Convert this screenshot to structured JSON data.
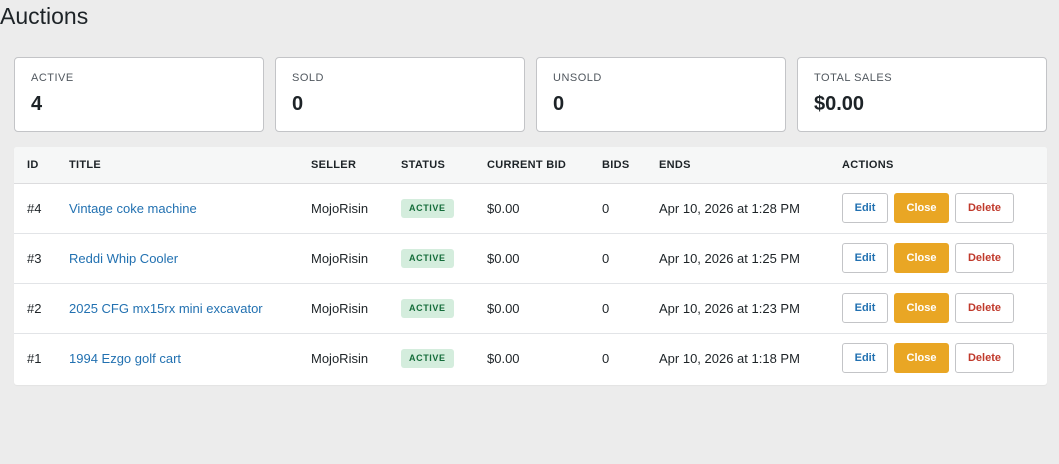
{
  "page": {
    "title": "Auctions"
  },
  "stats": [
    {
      "label": "ACTIVE",
      "value": "4"
    },
    {
      "label": "SOLD",
      "value": "0"
    },
    {
      "label": "UNSOLD",
      "value": "0"
    },
    {
      "label": "TOTAL SALES",
      "value": "$0.00"
    }
  ],
  "table": {
    "headers": [
      "ID",
      "TITLE",
      "SELLER",
      "STATUS",
      "CURRENT BID",
      "BIDS",
      "ENDS",
      "ACTIONS"
    ],
    "rows": [
      {
        "id": "#4",
        "title": "Vintage coke machine",
        "seller": "MojoRisin",
        "status": "ACTIVE",
        "current_bid": "$0.00",
        "bids": "0",
        "ends": "Apr 10, 2026 at 1:28 PM"
      },
      {
        "id": "#3",
        "title": "Reddi Whip Cooler",
        "seller": "MojoRisin",
        "status": "ACTIVE",
        "current_bid": "$0.00",
        "bids": "0",
        "ends": "Apr 10, 2026 at 1:25 PM"
      },
      {
        "id": "#2",
        "title": "2025 CFG mx15rx mini excavator",
        "seller": "MojoRisin",
        "status": "ACTIVE",
        "current_bid": "$0.00",
        "bids": "0",
        "ends": "Apr 10, 2026 at 1:23 PM"
      },
      {
        "id": "#1",
        "title": "1994 Ezgo golf cart",
        "seller": "MojoRisin",
        "status": "ACTIVE",
        "current_bid": "$0.00",
        "bids": "0",
        "ends": "Apr 10, 2026 at 1:18 PM"
      }
    ],
    "actions": {
      "edit": "Edit",
      "close": "Close",
      "delete": "Delete"
    }
  },
  "colors": {
    "link": "#2271b1",
    "close_button": "#e9a624",
    "delete_text": "#c0392b",
    "badge_bg": "#d4eddd",
    "badge_text": "#146c3a",
    "page_bg": "#ececec"
  }
}
